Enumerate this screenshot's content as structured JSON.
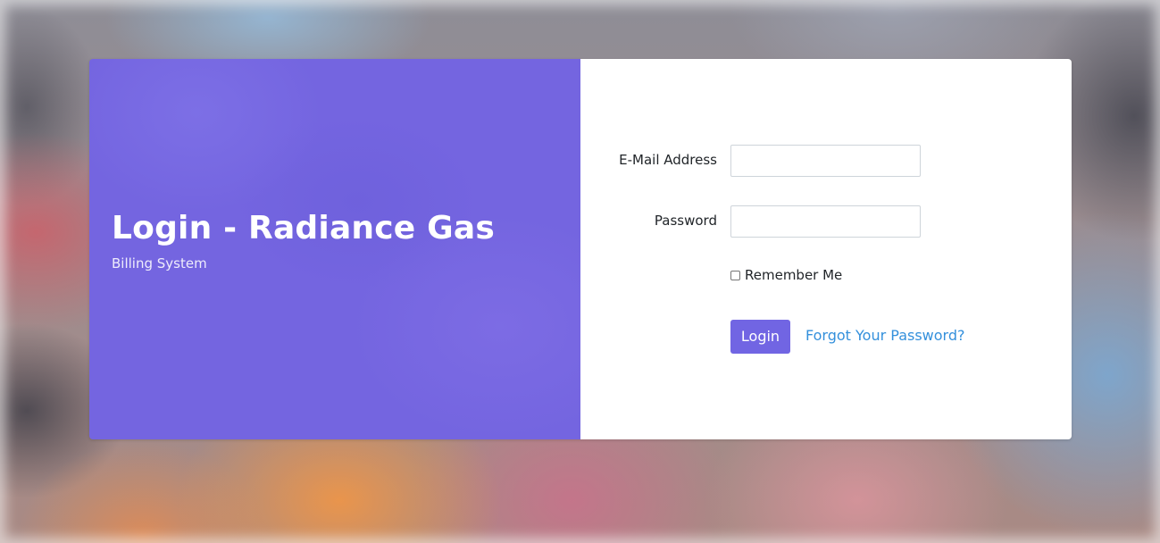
{
  "brand": {
    "title": "Login - Radiance Gas",
    "subtitle": "Billing System"
  },
  "form": {
    "email_label": "E-Mail Address",
    "email_value": "",
    "password_label": "Password",
    "password_value": "",
    "remember_label": "Remember Me",
    "remember_checked": false,
    "login_label": "Login",
    "forgot_label": "Forgot Your Password?"
  },
  "colors": {
    "accent": "#7165e3",
    "link": "#3490dc",
    "panel": "#7465e0"
  }
}
